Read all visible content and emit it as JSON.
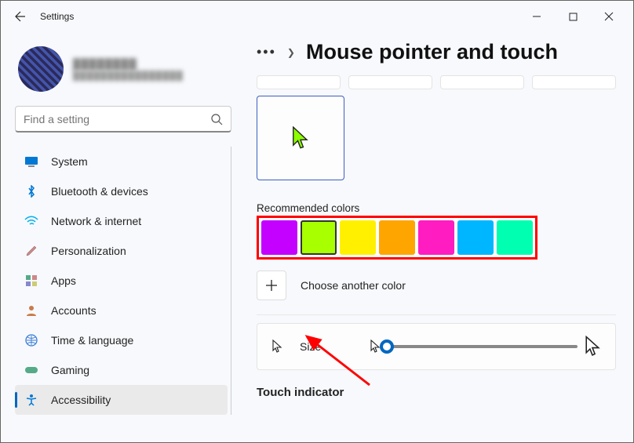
{
  "window": {
    "title": "Settings"
  },
  "profile": {
    "name": "████████",
    "email": "████████████████"
  },
  "search": {
    "placeholder": "Find a setting"
  },
  "nav": {
    "items": [
      {
        "key": "system",
        "label": "System"
      },
      {
        "key": "bluetooth",
        "label": "Bluetooth & devices"
      },
      {
        "key": "network",
        "label": "Network & internet"
      },
      {
        "key": "personalization",
        "label": "Personalization"
      },
      {
        "key": "apps",
        "label": "Apps"
      },
      {
        "key": "accounts",
        "label": "Accounts"
      },
      {
        "key": "time",
        "label": "Time & language"
      },
      {
        "key": "gaming",
        "label": "Gaming"
      },
      {
        "key": "accessibility",
        "label": "Accessibility"
      }
    ],
    "selected": "accessibility"
  },
  "breadcrumb": {
    "page_title": "Mouse pointer and touch"
  },
  "pointer": {
    "selected_color": "#8cff00",
    "recommended_label": "Recommended colors",
    "colors": [
      {
        "hex": "#c400ff",
        "selected": false
      },
      {
        "hex": "#a8ff00",
        "selected": true
      },
      {
        "hex": "#fff000",
        "selected": false
      },
      {
        "hex": "#ffa500",
        "selected": false
      },
      {
        "hex": "#ff1cc0",
        "selected": false
      },
      {
        "hex": "#00b7ff",
        "selected": false
      },
      {
        "hex": "#00ffb0",
        "selected": false
      }
    ],
    "choose_label": "Choose another color"
  },
  "size": {
    "label": "Size"
  },
  "touch": {
    "header": "Touch indicator"
  }
}
